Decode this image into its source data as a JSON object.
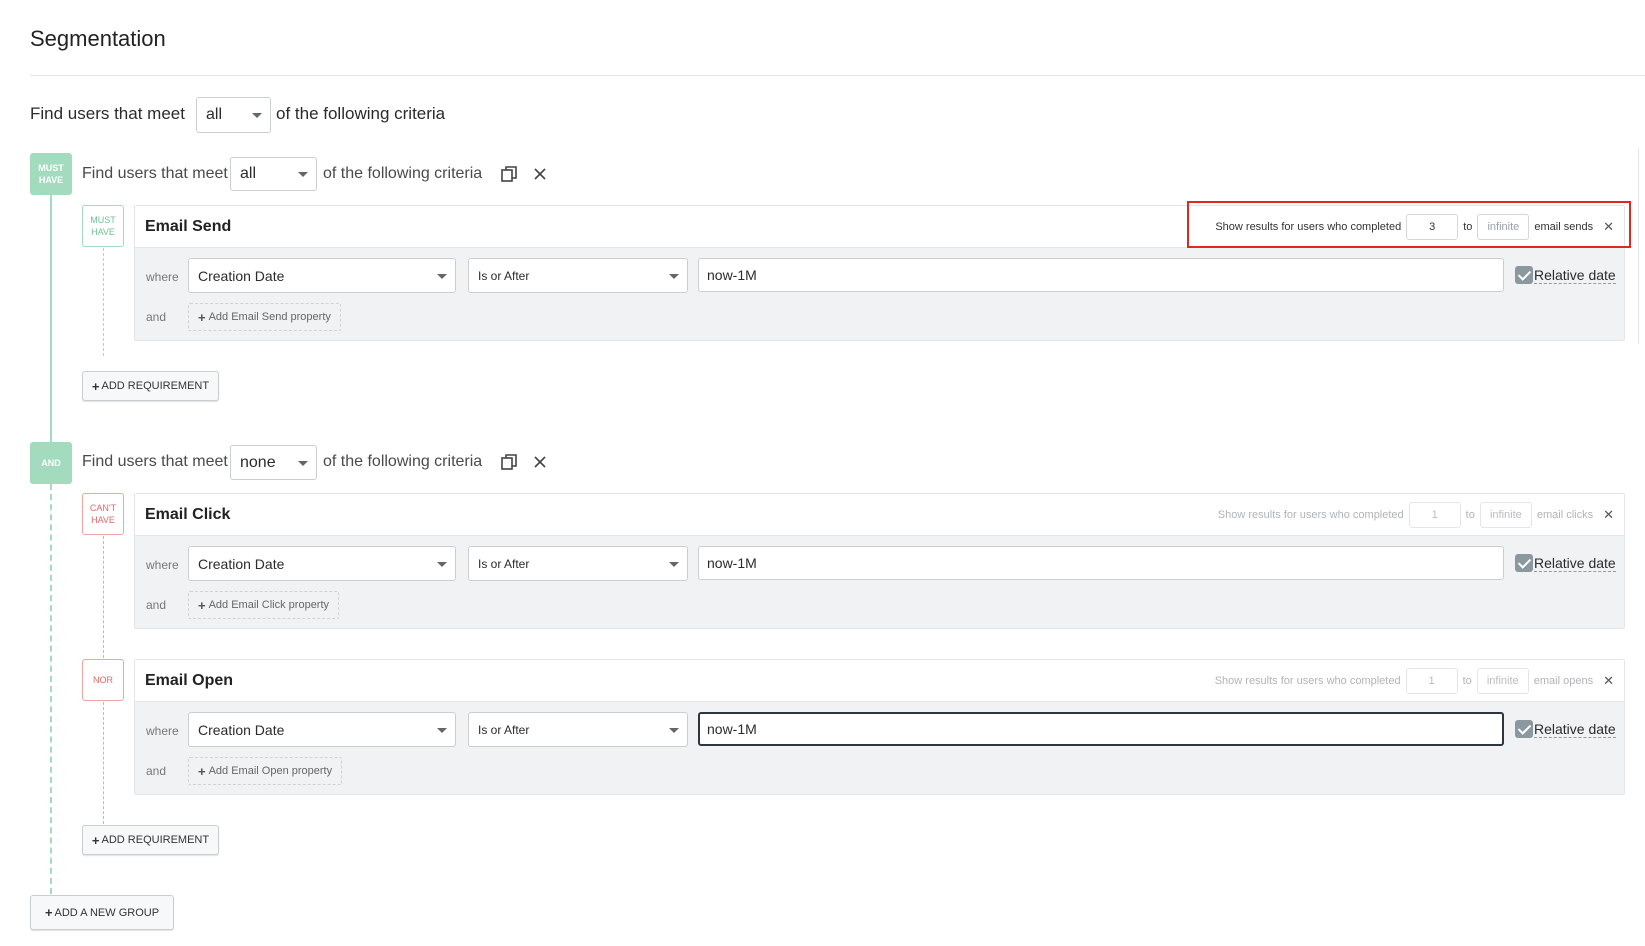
{
  "page": {
    "title": "Segmentation"
  },
  "top_criteria": {
    "prefix": "Find users that meet",
    "match": "all",
    "suffix": "of the following criteria"
  },
  "groups": [
    {
      "badge": "MUST HAVE",
      "prefix": "Find users that meet",
      "match": "all",
      "suffix": "of the following criteria",
      "requirements": [
        {
          "badge": "MUST HAVE",
          "title": "Email Send",
          "count_prefix": "Show results for users who completed",
          "count_min": "3",
          "count_to": "to",
          "count_max_placeholder": "infinite",
          "count_suffix": "email sends",
          "where_label": "where",
          "property": "Creation Date",
          "operator": "Is or After",
          "value": "now-1M",
          "relative_date_label": "Relative date",
          "relative_date_checked": true,
          "and_label": "and",
          "add_property_label": "Add Email Send property"
        }
      ],
      "add_requirement_label": "ADD REQUIREMENT"
    },
    {
      "badge": "AND",
      "prefix": "Find users that meet",
      "match": "none",
      "suffix": "of the following criteria",
      "requirements": [
        {
          "badge": "CAN'T HAVE",
          "title": "Email Click",
          "count_prefix": "Show results for users who completed",
          "count_min_placeholder": "1",
          "count_to": "to",
          "count_max_placeholder": "infinite",
          "count_suffix": "email clicks",
          "where_label": "where",
          "property": "Creation Date",
          "operator": "Is or After",
          "value": "now-1M",
          "relative_date_label": "Relative date",
          "relative_date_checked": true,
          "and_label": "and",
          "add_property_label": "Add Email Click property"
        },
        {
          "badge": "NOR",
          "title": "Email Open",
          "count_prefix": "Show results for users who completed",
          "count_min_placeholder": "1",
          "count_to": "to",
          "count_max_placeholder": "infinite",
          "count_suffix": "email opens",
          "where_label": "where",
          "property": "Creation Date",
          "operator": "Is or After",
          "value": "now-1M",
          "relative_date_label": "Relative date",
          "relative_date_checked": true,
          "and_label": "and",
          "add_property_label": "Add Email Open property"
        }
      ],
      "add_requirement_label": "ADD REQUIREMENT"
    }
  ],
  "add_group_label": "ADD A NEW GROUP",
  "colors": {
    "group_badge": "#a3dbbf",
    "must_have": "#6fbf96",
    "cant_have": "#e06767",
    "highlight": "#e0291e"
  }
}
